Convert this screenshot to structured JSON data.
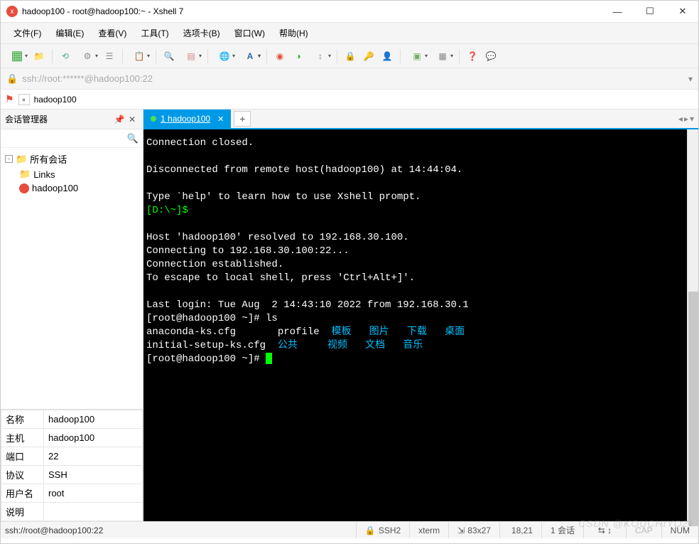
{
  "window": {
    "title": "hadoop100 - root@hadoop100:~ - Xshell 7"
  },
  "menu": {
    "file": "文件(F)",
    "edit": "编辑(E)",
    "view": "查看(V)",
    "tools": "工具(T)",
    "tabs": "选项卡(B)",
    "window": "窗口(W)",
    "help": "帮助(H)"
  },
  "address": {
    "url": "ssh://root:******@hadoop100:22"
  },
  "breadcrumb": {
    "label": "hadoop100"
  },
  "sidebar": {
    "title": "会话管理器",
    "root": "所有会话",
    "links": "Links",
    "session": "hadoop100"
  },
  "tab": {
    "index": "1",
    "label": "hadoop100"
  },
  "terminal": {
    "line_closed": "Connection closed.",
    "line_disc": "Disconnected from remote host(hadoop100) at 14:44:04.",
    "line_help": "Type `help' to learn how to use Xshell prompt.",
    "prompt_local": "[D:\\~]$",
    "line_resolve": "Host 'hadoop100' resolved to 192.168.30.100.",
    "line_connect": "Connecting to 192.168.30.100:22...",
    "line_est": "Connection established.",
    "line_escape": "To escape to local shell, press 'Ctrl+Alt+]'.",
    "line_last": "Last login: Tue Aug  2 14:43:10 2022 from 192.168.30.1",
    "prompt1": "[root@hadoop100 ~]# ",
    "cmd_ls": "ls",
    "ls_r1_c1": "anaconda-ks.cfg       profile  ",
    "ls_r1_c2": "模板   图片   下载   桌面",
    "ls_r2_c1": "initial-setup-ks.cfg  ",
    "ls_r2_c2": "公共     视频   文档   音乐",
    "prompt2": "[root@hadoop100 ~]# "
  },
  "props": {
    "name_k": "名称",
    "name_v": "hadoop100",
    "host_k": "主机",
    "host_v": "hadoop100",
    "port_k": "端口",
    "port_v": "22",
    "proto_k": "协议",
    "proto_v": "SSH",
    "user_k": "用户名",
    "user_v": "root",
    "desc_k": "说明",
    "desc_v": ""
  },
  "status": {
    "conn": "ssh://root@hadoop100:22",
    "ssh": "SSH2",
    "term": "xterm",
    "size": "83x27",
    "pos": "18,21",
    "sess": "1 会话",
    "cap": "CAP",
    "num": "NUM"
  },
  "watermark": "CSDN @KOUCHIYOZI"
}
